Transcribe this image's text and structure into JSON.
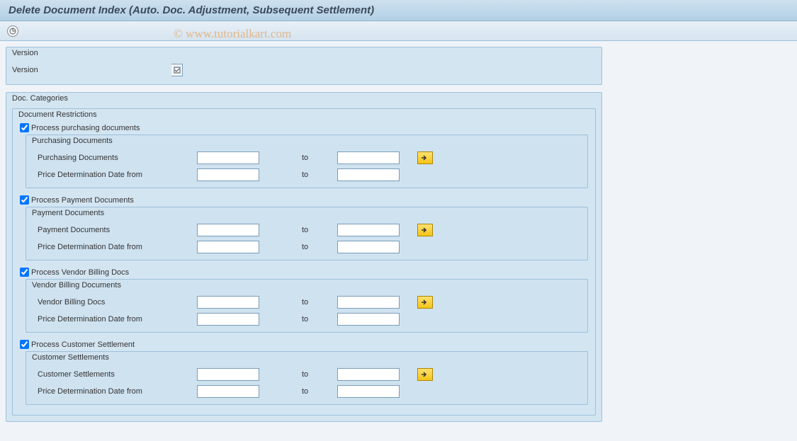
{
  "header": {
    "title": "Delete Document Index (Auto. Doc. Adjustment, Subsequent Settlement)"
  },
  "watermark": "© www.tutorialkart.com",
  "version_group": {
    "title": "Version",
    "label": "Version"
  },
  "doc_categories": {
    "title": "Doc. Categories",
    "restrictions_title": "Document Restrictions",
    "to_label": "to",
    "sections": [
      {
        "checkbox_label": "Process purchasing documents",
        "checked": true,
        "sub_title": "Purchasing Documents",
        "rows": [
          {
            "label": "Purchasing Documents",
            "has_multi": true
          },
          {
            "label": "Price Determination Date from",
            "has_multi": false
          }
        ]
      },
      {
        "checkbox_label": "Process Payment Documents",
        "checked": true,
        "sub_title": "Payment Documents",
        "rows": [
          {
            "label": "Payment Documents",
            "has_multi": true
          },
          {
            "label": "Price Determination Date from",
            "has_multi": false
          }
        ]
      },
      {
        "checkbox_label": "Process Vendor Billing Docs",
        "checked": true,
        "sub_title": "Vendor Billing Documents",
        "rows": [
          {
            "label": "Vendor Billing Docs",
            "has_multi": true
          },
          {
            "label": "Price Determination Date from",
            "has_multi": false
          }
        ]
      },
      {
        "checkbox_label": "Process Customer Settlement",
        "checked": true,
        "sub_title": "Customer Settlements",
        "rows": [
          {
            "label": "Customer Settlements",
            "has_multi": true
          },
          {
            "label": "Price Determination Date from",
            "has_multi": false
          }
        ]
      }
    ]
  }
}
